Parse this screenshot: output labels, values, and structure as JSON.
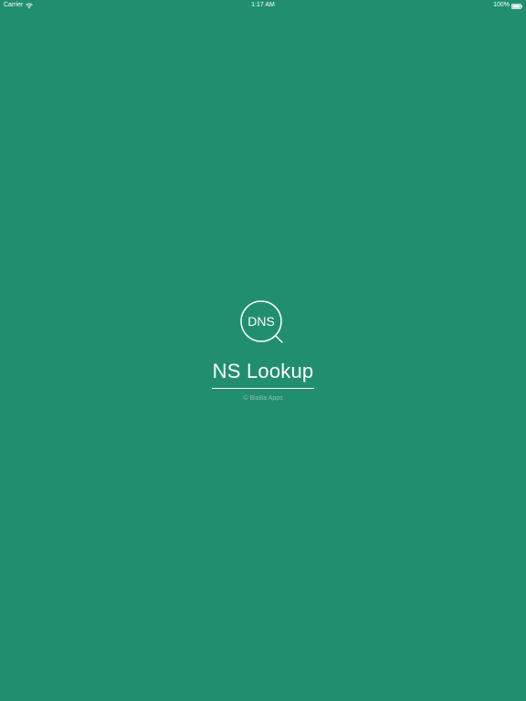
{
  "status_bar": {
    "carrier": "Carrier",
    "time": "1:17 AM",
    "battery": "100%",
    "icons": [
      "wifi-icon",
      "battery-icon"
    ]
  },
  "splash": {
    "logo_text": "DNS",
    "logo_icon": "magnifying-glass-icon",
    "title": "NS Lookup",
    "copyright": "© BiaBa Apps"
  },
  "colors": {
    "background": "#218f6c",
    "foreground": "#ffffff"
  }
}
